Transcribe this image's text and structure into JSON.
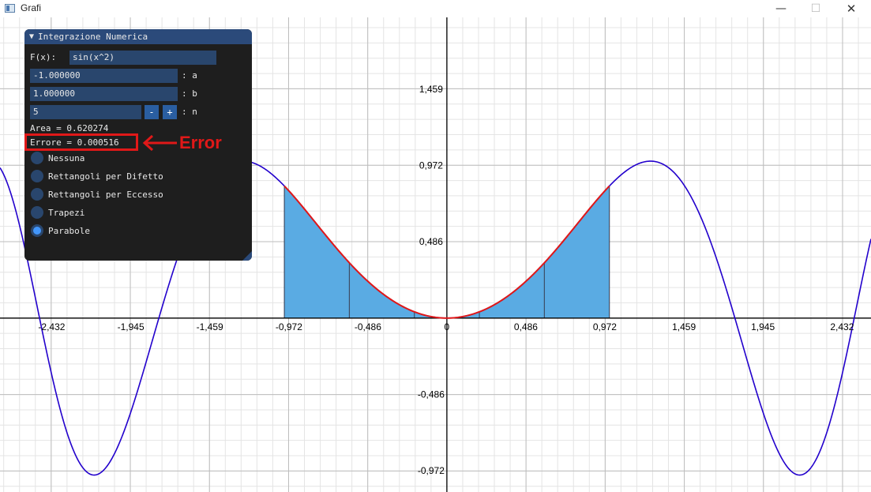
{
  "window": {
    "title": "Grafi",
    "minimize_glyph": "—",
    "maximize_glyph": "☐",
    "close_glyph": "✕"
  },
  "panel": {
    "title": "Integrazione Numerica",
    "fx_label": "F(x):",
    "fx_value": "sin(x^2)",
    "a_value": "-1.000000",
    "a_label": ": a",
    "b_value": "1.000000",
    "b_label": ": b",
    "n_value": "5",
    "n_label": ": n",
    "minus_label": "-",
    "plus_label": "+",
    "area_text": "Area = 0.620274",
    "error_text": "Errore = 0.000516",
    "methods": [
      {
        "label": "Nessuna",
        "selected": false
      },
      {
        "label": "Rettangoli per Difetto",
        "selected": false
      },
      {
        "label": "Rettangoli per Eccesso",
        "selected": false
      },
      {
        "label": "Trapezi",
        "selected": false
      },
      {
        "label": "Parabole",
        "selected": true
      }
    ]
  },
  "annotation": {
    "text": "Error",
    "color": "#e01818"
  },
  "colors": {
    "curve": "#2200cc",
    "fill": "#5aabe3",
    "highlight_curve": "#e01818",
    "grid_minor": "#e4e4e4",
    "grid_major": "#bdbdbd",
    "axis": "#000000"
  },
  "chart_data": {
    "type": "line",
    "function": "sin(x^2)",
    "x_ticks": [
      "-2,432",
      "-1,945",
      "-1,459",
      "-0,972",
      "-0,486",
      "0",
      "0,486",
      "0,972",
      "1,459",
      "1,945",
      "2,432"
    ],
    "y_ticks": [
      "1,459",
      "0,972",
      "0,486",
      "-0,486",
      "-0,972"
    ],
    "x_tick_values": [
      -2.432,
      -1.945,
      -1.459,
      -0.972,
      -0.486,
      0,
      0.486,
      0.972,
      1.459,
      1.945,
      2.432
    ],
    "y_tick_values": [
      1.459,
      0.972,
      0.486,
      -0.486,
      -0.972
    ],
    "xlim": [
      -2.75,
      2.61
    ],
    "ylim": [
      -1.108,
      1.916
    ],
    "integration": {
      "a": -1.0,
      "b": 1.0,
      "n": 5,
      "method": "Parabole",
      "shaded_subintervals": [
        -1.0,
        -0.6,
        -0.2,
        0.2,
        0.6,
        1.0
      ]
    },
    "grid": true
  }
}
